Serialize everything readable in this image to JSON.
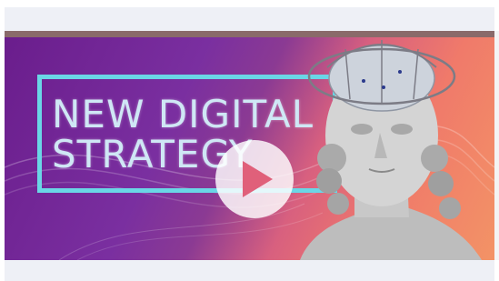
{
  "video": {
    "title": "NEW DIGITAL\nSTRATEGY",
    "play_icon": "play-icon",
    "colors": {
      "purple": "#6a1d8c",
      "coral": "#f07a6a",
      "frame": "#6ad6e6",
      "play_bg": "#ffffff",
      "play_glyph": "#e0607a"
    }
  }
}
